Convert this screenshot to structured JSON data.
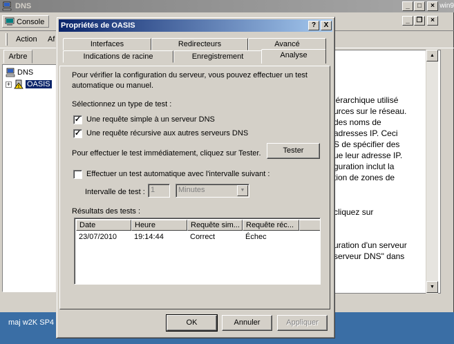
{
  "mmc": {
    "title": "DNS",
    "title_right_fragment": "win9",
    "console_menu": "Console",
    "toolbar": {
      "action": "Action",
      "affichage_fragment": "Af"
    },
    "left_tab": "Arbre",
    "tree": {
      "root": "DNS",
      "server": "OASIS"
    },
    "right_text_lines": [
      "iérarchique utilisé",
      "urces sur le réseau.",
      "des noms de",
      " adresses IP. Ceci",
      "S de spécifier des",
      "ue leur adresse IP.",
      "guration inclut la",
      "tion de zones de",
      "",
      "",
      "cliquez sur",
      "",
      "",
      "uration d'un serveur",
      "serveur DNS\" dans"
    ],
    "taskbar_label": "maj w2K SP4"
  },
  "dialog": {
    "title": "Propriétés de OASIS",
    "help_btn": "?",
    "close_btn": "X",
    "tabs_back": [
      "Interfaces",
      "Redirecteurs",
      "Avancé"
    ],
    "tabs_front": [
      "Indications de racine",
      "Enregistrement",
      "Analyse"
    ],
    "active_tab": "Analyse",
    "intro_line1": "Pour vérifier la configuration du serveur, vous pouvez effectuer un test",
    "intro_line2": "automatique ou manuel.",
    "select_type": "Sélectionnez un type de test :",
    "check_simple": {
      "label": "Une requête simple à un serveur DNS",
      "checked": true
    },
    "check_recursive": {
      "label": "Une requête récursive aux autres serveurs DNS",
      "checked": true
    },
    "immediate_text": "Pour effectuer le test immédiatement, cliquez sur Tester.",
    "test_button": "Tester",
    "check_auto": {
      "label": "Effectuer un test automatique avec l'intervalle suivant :",
      "checked": false
    },
    "interval_label": "Intervalle de test :",
    "interval_value": "1",
    "interval_unit": "Minutes",
    "results_label": "Résultats des tests :",
    "results_columns": [
      "Date",
      "Heure",
      "Requête sim...",
      "Requête réc..."
    ],
    "results_rows": [
      [
        "23/07/2010",
        "19:14:44",
        "Correct",
        "Échec"
      ]
    ],
    "ok_button": "OK",
    "cancel_button": "Annuler",
    "apply_button": "Appliquer"
  }
}
